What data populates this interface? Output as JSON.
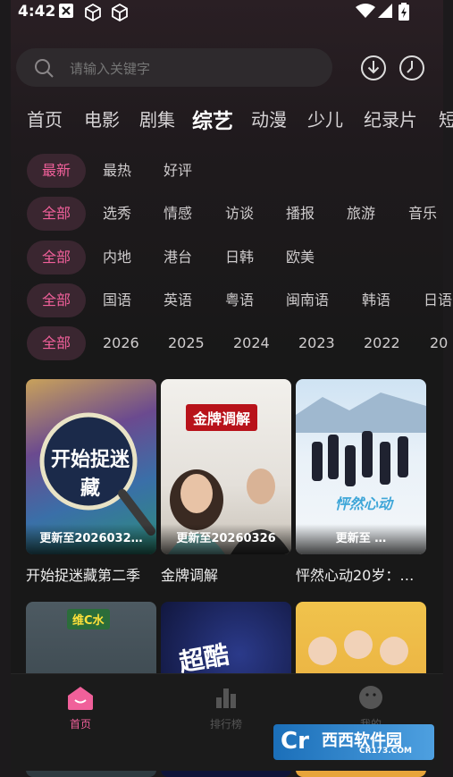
{
  "status": {
    "time": "4:42"
  },
  "search": {
    "placeholder": "请输入关键字"
  },
  "categories": [
    "首页",
    "电影",
    "剧集",
    "综艺",
    "动漫",
    "少儿",
    "纪录片",
    "短"
  ],
  "active_category": "综艺",
  "filters": {
    "sort": [
      "最新",
      "最热",
      "好评"
    ],
    "genre": [
      "全部",
      "选秀",
      "情感",
      "访谈",
      "播报",
      "旅游",
      "音乐"
    ],
    "region": [
      "全部",
      "内地",
      "港台",
      "日韩",
      "欧美"
    ],
    "language": [
      "全部",
      "国语",
      "英语",
      "粤语",
      "闽南语",
      "韩语",
      "日语"
    ],
    "year": [
      "全部",
      "2026",
      "2025",
      "2024",
      "2023",
      "2022",
      "20"
    ]
  },
  "cards": [
    {
      "title": "开始捉迷藏第二季",
      "badge": "更新至2026032…",
      "poster_text": "开始捉迷藏"
    },
    {
      "title": "金牌调解",
      "badge": "更新至20260326",
      "poster_text": "金牌调解"
    },
    {
      "title": "怦然心动20岁：…",
      "badge": "更新至        …",
      "poster_text": "怦然心动"
    },
    {
      "title": "",
      "badge": "",
      "poster_text": "维C水"
    },
    {
      "title": "",
      "badge": "",
      "poster_text": "超酷"
    },
    {
      "title": "",
      "badge": "",
      "poster_text": ""
    }
  ],
  "nav": [
    {
      "label": "首页",
      "active": true
    },
    {
      "label": "排行榜",
      "active": false
    },
    {
      "label": "我的",
      "active": false
    }
  ],
  "colors": {
    "accent": "#f0609a",
    "chip_bg": "#3a2630",
    "background": "#181818"
  },
  "watermark": {
    "text": "西西软件园",
    "sub": "CR173.COM"
  }
}
